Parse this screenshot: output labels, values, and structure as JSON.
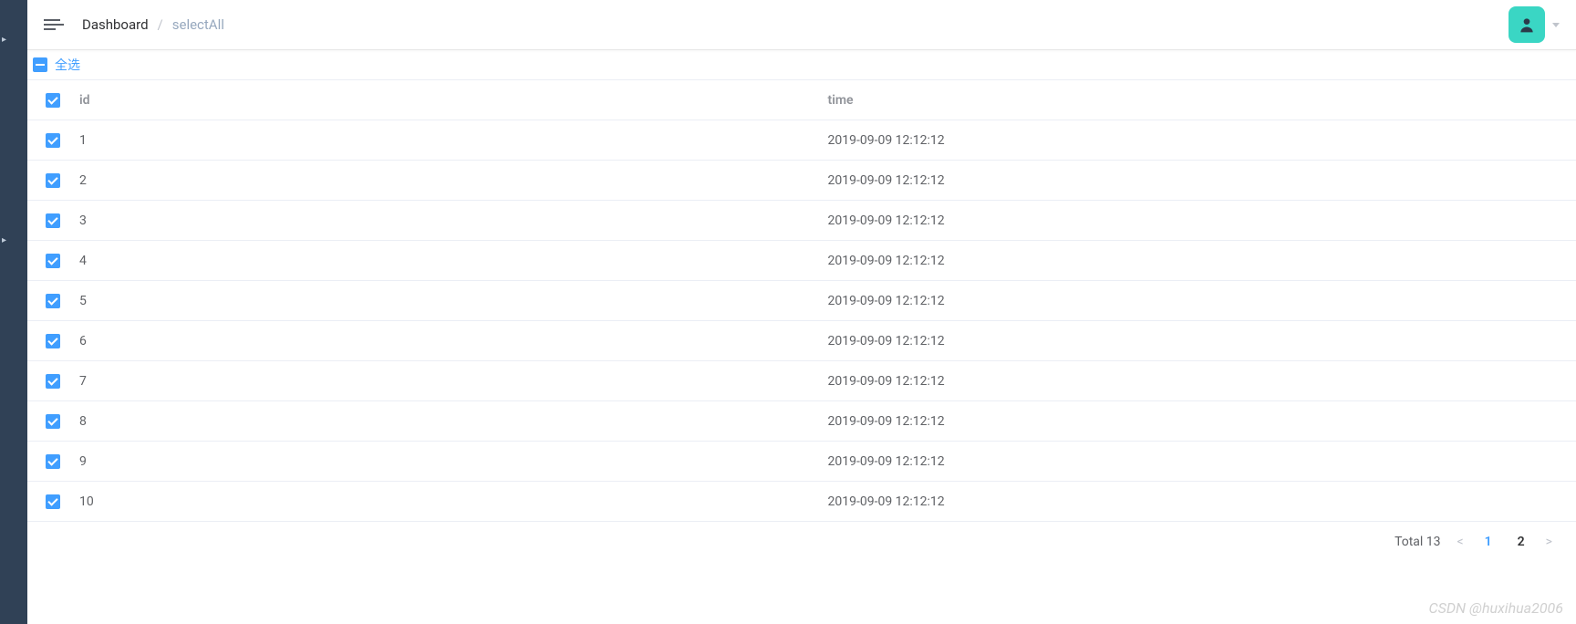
{
  "breadcrumb": {
    "root": "Dashboard",
    "sep": "/",
    "current": "selectAll"
  },
  "selectAll": {
    "label": "全选"
  },
  "table": {
    "headers": {
      "id": "id",
      "time": "time"
    },
    "rows": [
      {
        "id": "1",
        "time": "2019-09-09 12:12:12"
      },
      {
        "id": "2",
        "time": "2019-09-09 12:12:12"
      },
      {
        "id": "3",
        "time": "2019-09-09 12:12:12"
      },
      {
        "id": "4",
        "time": "2019-09-09 12:12:12"
      },
      {
        "id": "5",
        "time": "2019-09-09 12:12:12"
      },
      {
        "id": "6",
        "time": "2019-09-09 12:12:12"
      },
      {
        "id": "7",
        "time": "2019-09-09 12:12:12"
      },
      {
        "id": "8",
        "time": "2019-09-09 12:12:12"
      },
      {
        "id": "9",
        "time": "2019-09-09 12:12:12"
      },
      {
        "id": "10",
        "time": "2019-09-09 12:12:12"
      }
    ]
  },
  "pagination": {
    "totalLabel": "Total 13",
    "prev": "<",
    "next": ">",
    "pages": [
      {
        "num": "1",
        "active": true
      },
      {
        "num": "2",
        "active": false
      }
    ]
  },
  "watermark": "CSDN @huxihua2006"
}
